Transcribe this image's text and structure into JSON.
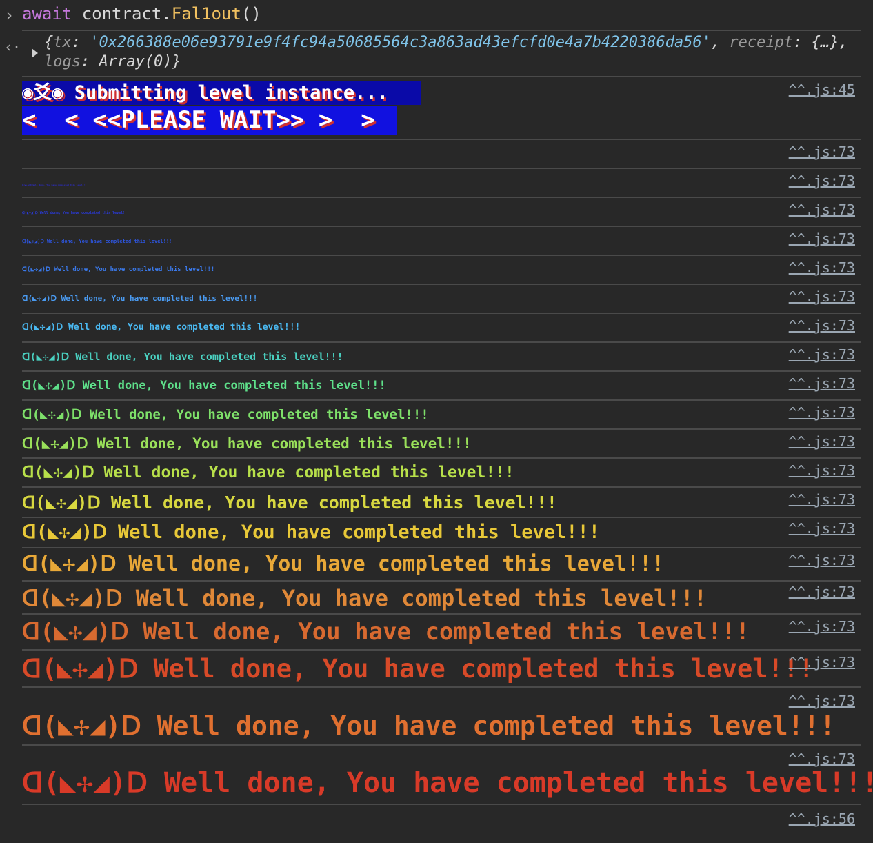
{
  "command": {
    "prompt_icon": "›",
    "keyword": "await",
    "object": " contract.",
    "function": "Fal1out",
    "parens": "()"
  },
  "result": {
    "return_icon": "‹·",
    "line1_open": "{",
    "tx_key": "tx",
    "tx_value": "'0x266388e06e93791e9f4fc94a50685564c3a863ad43efcfd0e4a7b4220386da56'",
    "receipt_key": "receipt",
    "receipt_value": "{…}",
    "logs_key": "logs",
    "logs_value": "Array(0)}"
  },
  "banner": {
    "line1": "◉爻◉ Submitting level instance...",
    "line2": "<  < <<PLEASE WAIT>> >  >"
  },
  "source_links": {
    "banner": "^^.js:45",
    "message": "^^.js:73",
    "final": "^^.js:56"
  },
  "message_text": "ᗡ(◣✢◢)ᗞ Well done, You have completed this level!!!",
  "colors": {
    "background": "#282828",
    "banner_bg_1": "#0a0aa8",
    "banner_bg_2": "#1111e0",
    "message_gradient": [
      "#4a1aa0",
      "#2d2dc8",
      "#2a3ad8",
      "#2d55e0",
      "#3a78e8",
      "#4a9af0",
      "#4ab8f0",
      "#4ad0c0",
      "#5ee08a",
      "#7ee06a",
      "#9ae05a",
      "#b8e04a",
      "#d8d840",
      "#e8c838",
      "#e8a838",
      "#e08838",
      "#d86a30",
      "#d84a28"
    ]
  }
}
